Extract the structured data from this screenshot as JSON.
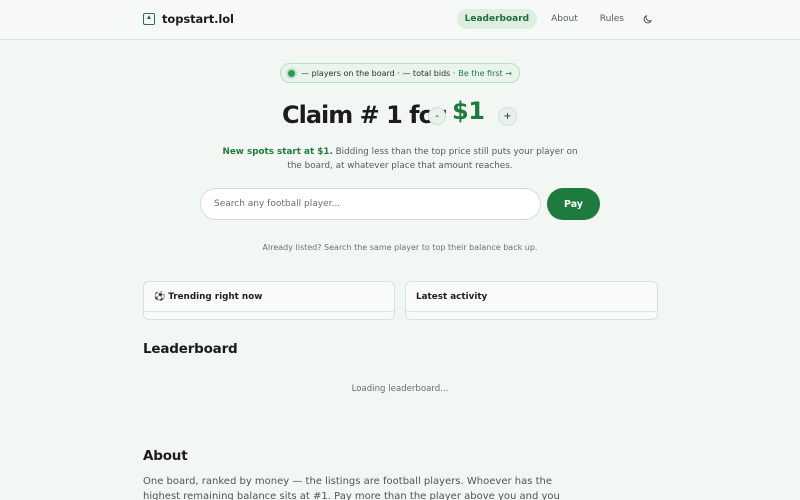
{
  "header": {
    "brand": "topstart.lol",
    "nav": [
      "Leaderboard",
      "About",
      "Rules"
    ],
    "active_nav": "Leaderboard",
    "theme_icon": "moon-icon"
  },
  "status_pill": {
    "text": "— players on the board · — total bids ·",
    "link": "Be the first →",
    "dot_color": "#2b9a52"
  },
  "hero": {
    "title": "Claim # 1 for",
    "minus": "-",
    "price": "$1",
    "plus": "+",
    "subtext_bold": "New spots start at $1.",
    "subtext": "Bidding less than the top price still puts your player on the board, at whatever place that amount reaches."
  },
  "search": {
    "placeholder": "Search any football player...",
    "value": "",
    "button": "Pay",
    "hint": "Already listed? Search the same player to top their balance back up."
  },
  "cards": {
    "trending_icon": "⚽",
    "trending": "Trending right now",
    "activity": "Latest activity"
  },
  "leaderboard": {
    "title": "Leaderboard",
    "loading": "Loading leaderboard..."
  },
  "about": {
    "title": "About",
    "text": "One board, ranked by money — the listings are football players. Whoever has the highest remaining balance sits at #1. Pay more than the player above you and you take their spot."
  },
  "colors": {
    "accent": "#1f7a3e",
    "background": "#f3f7f4",
    "active_nav_bg": "#dcefe1"
  }
}
